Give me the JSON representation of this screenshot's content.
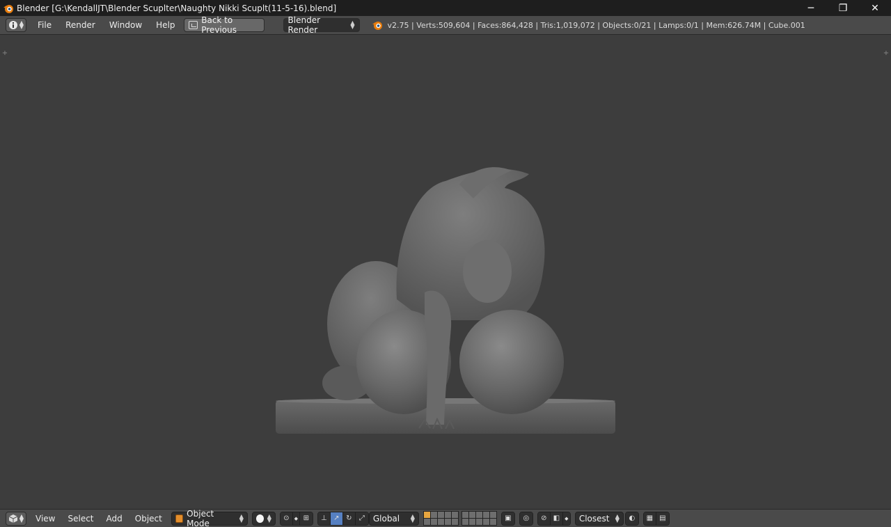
{
  "titlebar": {
    "title": "Blender [G:\\KendallJT\\Blender Scuplter\\Naughty Nikki Scuplt(11-5-16).blend]",
    "minimize": "─",
    "restore": "❐",
    "close": "✕"
  },
  "info_header": {
    "menu": [
      "File",
      "Render",
      "Window",
      "Help"
    ],
    "back_button": "Back to Previous",
    "render_engine": "Blender Render",
    "stats": "v2.75 | Verts:509,604 | Faces:864,428 | Tris:1,019,072 | Objects:0/21 | Lamps:0/1 | Mem:626.74M | Cube.001"
  },
  "viewport_header": {
    "menu": [
      "View",
      "Select",
      "Add",
      "Object"
    ],
    "mode": "Object Mode",
    "orientation": "Global",
    "snap_target": "Closest"
  },
  "colors": {
    "background": "#3d3d3d",
    "header": "#4a4a4a",
    "titlebar": "#1e1e1e",
    "accent_blue": "#5680c2",
    "accent_orange": "#e38e2c",
    "model_gray": "#6a6a6a"
  },
  "icons": {
    "app": "blender-logo-icon",
    "editor_type": "info-icon",
    "viewport_editor": "3d-view-icon"
  }
}
